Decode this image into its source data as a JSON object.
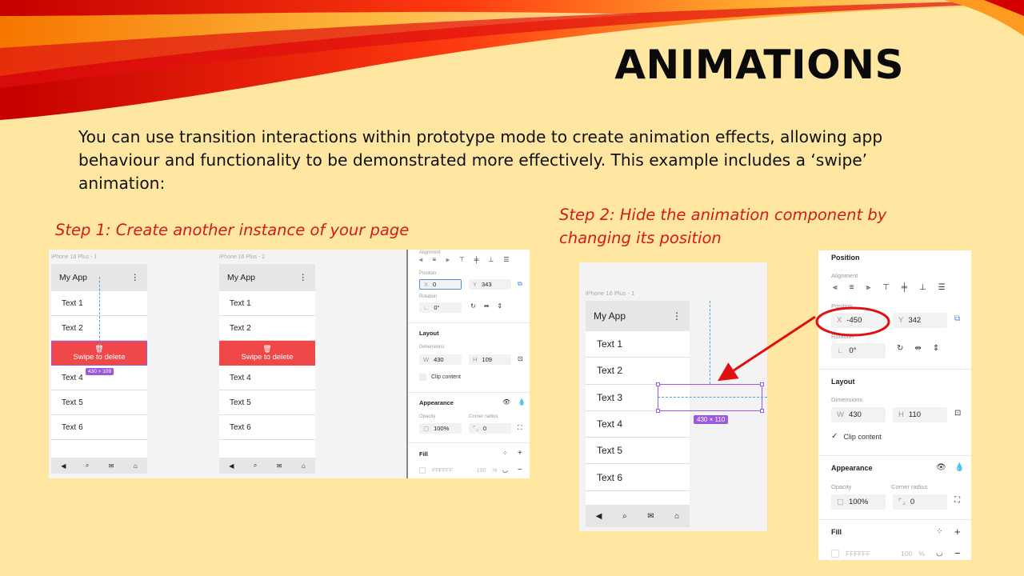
{
  "slide": {
    "title": "ANIMATIONS",
    "intro": "You can use transition interactions within prototype mode to create animation effects, allowing app behaviour and functionality to be demonstrated more effectively. This example includes a ‘swipe’ animation:",
    "step1": "Step 1: Create another instance of your page",
    "step2": "Step 2: Hide the animation component by changing its position"
  },
  "shot1": {
    "frame1_label": "iPhone 16 Plus - 1",
    "frame2_label": "iPhone 16 Plus - 2",
    "app_title": "My App",
    "menu_icon": "⋮",
    "rows_top": [
      "Text 1",
      "Text 2"
    ],
    "delete_label": "Swipe to delete",
    "rows_bottom": [
      "Text 4",
      "Text 5",
      "Text 6"
    ],
    "size_badge": "430 × 109",
    "panel": {
      "alignment": "Alignment",
      "position": "Position",
      "x_key": "X",
      "x_val": "0",
      "y_key": "Y",
      "y_val": "343",
      "rotation": "Rotation",
      "rot_val": "0°",
      "layout": "Layout",
      "dimensions": "Dimensions",
      "w_key": "W",
      "w_val": "430",
      "h_key": "H",
      "h_val": "109",
      "clip": "Clip content",
      "appearance": "Appearance",
      "opacity": "Opacity",
      "corner_radius": "Corner radius",
      "opacity_val": "100%",
      "radius_val": "0",
      "fill": "Fill",
      "fill_hex": "FFFFFF",
      "fill_pct": "100",
      "fill_unit": "%"
    }
  },
  "shot2": {
    "frame_label": "iPhone 16 Plus - 1",
    "app_title": "My App",
    "menu_icon": "⋮",
    "rows": [
      "Text 1",
      "Text 2",
      "Text 3",
      "Text 4",
      "Text 5",
      "Text 6"
    ],
    "size_badge": "430 × 110",
    "panel": {
      "position_title": "Position",
      "alignment": "Alignment",
      "position": "Position",
      "x_key": "X",
      "x_val": "-450",
      "y_key": "Y",
      "y_val": "342",
      "rotation": "Rotation",
      "rot_val": "0°",
      "layout": "Layout",
      "dimensions": "Dimensions",
      "w_key": "W",
      "w_val": "430",
      "h_key": "H",
      "h_val": "110",
      "clip": "Clip content",
      "appearance": "Appearance",
      "opacity": "Opacity",
      "corner_radius": "Corner radius",
      "opacity_val": "100%",
      "radius_val": "0",
      "fill": "Fill",
      "fill_hex": "FFFFFF",
      "fill_pct": "100",
      "fill_unit": "%"
    }
  },
  "colors": {
    "background": "#FFE6A1",
    "accent_red": "#D41B1B",
    "delete_red": "#F04848",
    "selection": "#9B59E0"
  }
}
